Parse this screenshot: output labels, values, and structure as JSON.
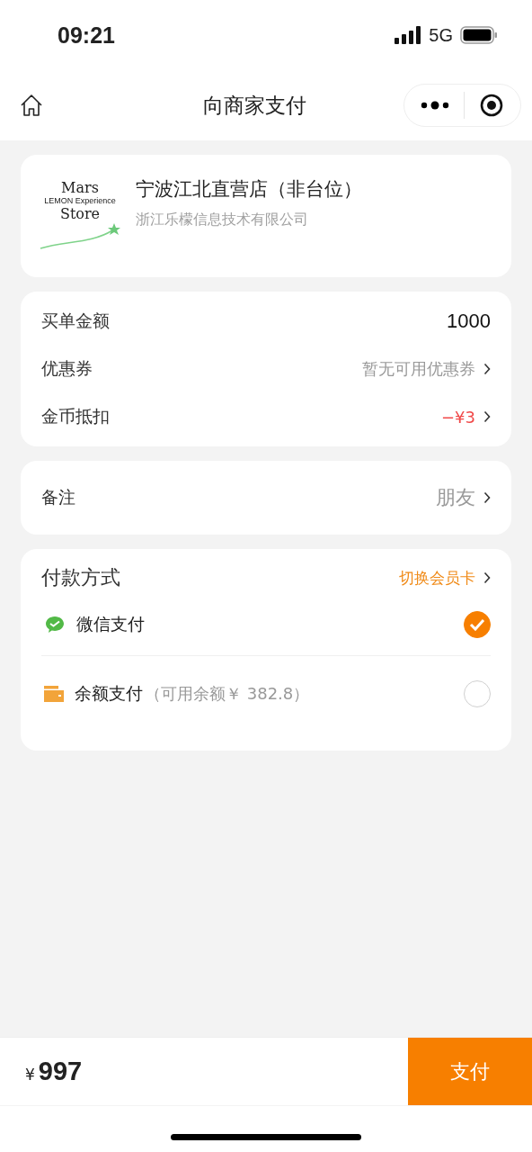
{
  "status_bar": {
    "time": "09:21",
    "network": "5G"
  },
  "nav": {
    "title": "向商家支付"
  },
  "store": {
    "logo": {
      "line1": "Mars",
      "line2": "Store",
      "tagline": "LEMON Experience"
    },
    "name": "宁波江北直营店（非台位）",
    "company": "浙江乐檬信息技术有限公司"
  },
  "bill": [
    {
      "label": "买单金额",
      "value": "1000",
      "color": "#111111",
      "arrow": false
    },
    {
      "label": "优惠券",
      "value": "暂无可用优惠券",
      "color": "#999999",
      "arrow": true
    },
    {
      "label": "金币抵扣",
      "value": "−¥3",
      "color": "#f04848",
      "arrow": true
    }
  ],
  "remark": {
    "label": "备注",
    "value": "朋友"
  },
  "payment": {
    "title": "付款方式",
    "switch_link": "切换会员卡",
    "methods": [
      {
        "kind": "wechat",
        "label": "微信支付",
        "selected": true
      },
      {
        "kind": "wallet",
        "label": "余额支付",
        "note": "（可用余额￥ 382.8）",
        "selected": false
      }
    ]
  },
  "footer": {
    "currency": "¥",
    "total": "997",
    "pay_button": "支付"
  }
}
